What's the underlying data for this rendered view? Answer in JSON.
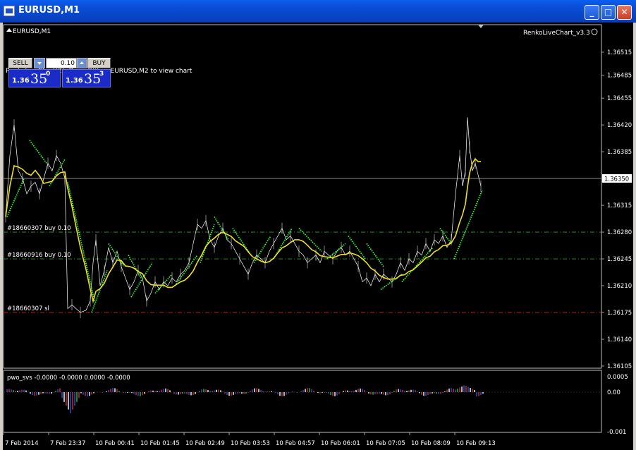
{
  "window": {
    "title": "EURUSD,M1"
  },
  "chart": {
    "symbol_label": "EURUSD,M1",
    "indicator_label": "RenkoLiveChart_v3.3",
    "info_text": "RenkoLiveChart(2): Open Offline EURUSD,M2 to view chart",
    "current_price": "1.36350",
    "price_ticks": [
      "1.36515",
      "1.36485",
      "1.36455",
      "1.36420",
      "1.36385",
      "1.36315",
      "1.36280",
      "1.36245",
      "1.36210",
      "1.36175",
      "1.36140",
      "1.36105"
    ],
    "order_lines": [
      {
        "label": "#18660307 buy 0.10",
        "price": 1.3628,
        "color": "#2f9e2f"
      },
      {
        "label": "#18660916 buy 0.10",
        "price": 1.36245,
        "color": "#2f9e2f"
      },
      {
        "label": "#18660307 sl",
        "price": 1.36175,
        "color": "#d02020"
      }
    ],
    "time_labels": [
      "7 Feb 2014",
      "7 Feb 23:37",
      "10 Feb 00:41",
      "10 Feb 01:45",
      "10 Feb 02:49",
      "10 Feb 03:53",
      "10 Feb 04:57",
      "10 Feb 06:01",
      "10 Feb 07:05",
      "10 Feb 08:09",
      "10 Feb 09:13"
    ]
  },
  "trade_panel": {
    "sell_label": "SELL",
    "buy_label": "BUY",
    "volume": "0.10",
    "sell_price": {
      "prefix": "1.36",
      "big": "35",
      "sup": "0"
    },
    "buy_price": {
      "prefix": "1.36",
      "big": "35",
      "sup": "3"
    }
  },
  "sub_window": {
    "label": "pwo_svs -0.0000 -0.0000 0.0000 -0.0000",
    "ticks": [
      "0.0005",
      "0.00",
      "-0.001"
    ]
  },
  "colors": {
    "price_line": "#ffffff",
    "ma_line": "#f0e020",
    "renko_dots": "#30ff30",
    "grid_text": "#ffffff"
  }
}
